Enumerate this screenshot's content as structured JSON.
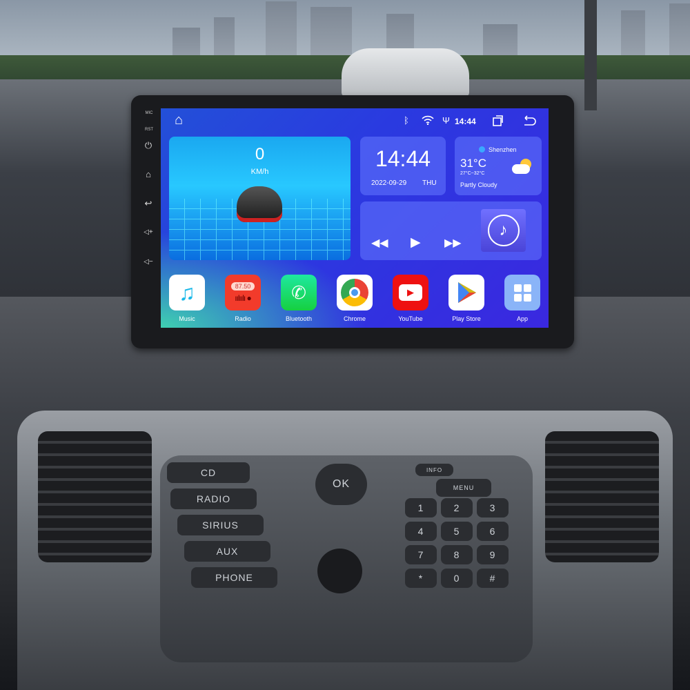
{
  "bezel": {
    "mic_label": "MIC",
    "rst_label": "RST"
  },
  "status_bar": {
    "time": "14:44",
    "icons": [
      "home-icon",
      "bluetooth-icon",
      "wifi-icon",
      "usb-icon",
      "recent-apps-icon",
      "back-icon"
    ]
  },
  "speed_widget": {
    "value": "0",
    "unit": "KM/h"
  },
  "clock_widget": {
    "time": "14:44",
    "date": "2022-09-29",
    "weekday": "THU"
  },
  "weather_widget": {
    "city": "Shenzhen",
    "temperature": "31°C",
    "range": "27°C~32°C",
    "condition": "Partly Cloudy"
  },
  "media_widget": {
    "controls": [
      "rewind-icon",
      "play-icon",
      "fast-forward-icon"
    ]
  },
  "apps": [
    {
      "label": "Music",
      "color": "#ffffff"
    },
    {
      "label": "Radio",
      "color": "#f23b2b",
      "frequency": "87.50"
    },
    {
      "label": "Bluetooth",
      "color": "#1ed760"
    },
    {
      "label": "Chrome",
      "color": "#ffffff"
    },
    {
      "label": "YouTube",
      "color": "#ee1111"
    },
    {
      "label": "Play Store",
      "color": "#ffffff"
    },
    {
      "label": "App",
      "color": "#8ab4f8"
    }
  ],
  "console": {
    "buttons": [
      "CD",
      "RADIO",
      "SIRIUS",
      "AUX",
      "PHONE"
    ],
    "ok": "OK",
    "menu": "MENU",
    "info": "INFO",
    "keypad": [
      "1",
      "2",
      "3",
      "4",
      "5",
      "6",
      "7",
      "8",
      "9",
      "*",
      "0",
      "#"
    ]
  }
}
